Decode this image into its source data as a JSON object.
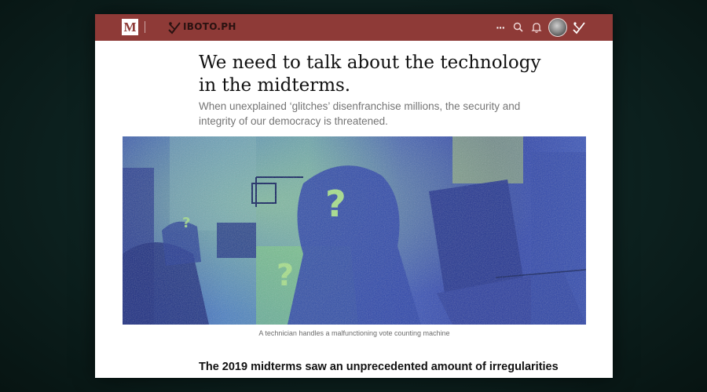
{
  "topbar": {
    "logo_letter": "M",
    "publication_name": "IBOTO.PH",
    "more_label": "···",
    "icons": [
      "medium-logo",
      "ballot-check-icon",
      "more-icon",
      "search-icon",
      "bell-icon",
      "avatar",
      "ballot-check-icon"
    ],
    "background_color": "#8e3a37"
  },
  "article": {
    "title": "We need to talk about the technology in the midterms.",
    "subtitle": "When unexplained ‘glitches’ disenfranchise millions, the security and integrity of our democracy is threatened.",
    "image_caption": "A technician handles a malfunctioning vote counting machine",
    "section_heading": "The 2019 midterms saw an unprecedented amount of irregularities"
  },
  "colors": {
    "accent": "#8e3a37",
    "hero_blue": "#2f4bb3",
    "hero_green": "#a6e08a"
  }
}
